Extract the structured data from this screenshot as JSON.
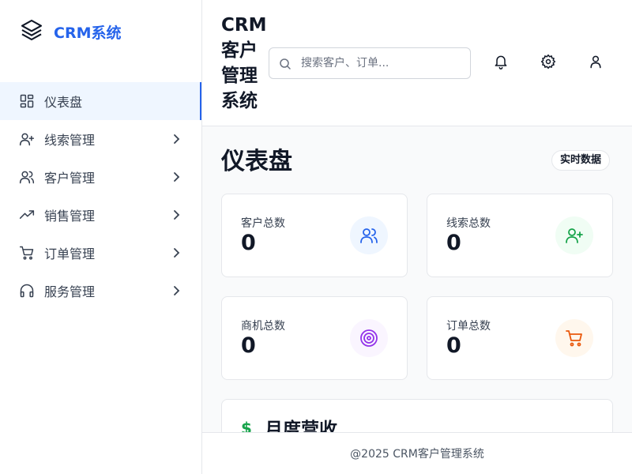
{
  "brand": {
    "name": "CRM系统",
    "icon": "layers-icon"
  },
  "nav": {
    "items": [
      {
        "label": "仪表盘",
        "icon": "dashboard-grid-icon",
        "active": true
      },
      {
        "label": "线索管理",
        "icon": "user-plus-icon"
      },
      {
        "label": "客户管理",
        "icon": "users-icon"
      },
      {
        "label": "销售管理",
        "icon": "trending-up-icon"
      },
      {
        "label": "订单管理",
        "icon": "cart-icon"
      },
      {
        "label": "服务管理",
        "icon": "headset-icon"
      }
    ]
  },
  "header": {
    "title": "CRM客户管理系统",
    "search_placeholder": "搜索客户、订单...",
    "icons": [
      "bell-icon",
      "gear-icon",
      "user-icon"
    ]
  },
  "main": {
    "page_title": "仪表盘",
    "badge": "实时数据",
    "stats": [
      {
        "label": "客户总数",
        "value": "0",
        "icon": "users-icon",
        "color": "#2563eb",
        "bg": "#eff6ff"
      },
      {
        "label": "线索总数",
        "value": "0",
        "icon": "user-plus-icon",
        "color": "#16a34a",
        "bg": "#f0fdf4"
      },
      {
        "label": "商机总数",
        "value": "0",
        "icon": "target-icon",
        "color": "#9333ea",
        "bg": "#faf5ff"
      },
      {
        "label": "订单总数",
        "value": "0",
        "icon": "cart-icon",
        "color": "#ea580c",
        "bg": "#fff7ed"
      }
    ],
    "revenue": {
      "title": "月度营收",
      "icon": "dollar-icon",
      "icon_glyph": "$"
    }
  },
  "footer": {
    "text": "@2025 CRM客户管理系统"
  },
  "colors": {
    "accent": "#2563eb",
    "border": "#e5e7eb",
    "bg": "#f9fafb"
  }
}
